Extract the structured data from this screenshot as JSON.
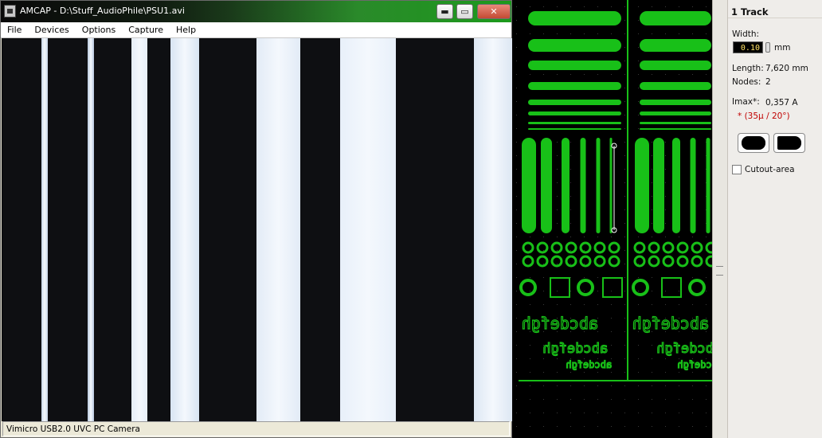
{
  "amcap": {
    "title": "AMCAP - D:\\Stuff_AudioPhile\\PSU1.avi",
    "menu": [
      "File",
      "Devices",
      "Options",
      "Capture",
      "Help"
    ],
    "status_text": "Vimicro USB2.0 UVC PC Camera",
    "window_buttons": {
      "minimize": "▬",
      "maximize": "▭",
      "close": "✕"
    }
  },
  "pcb_editor": {
    "silkscreen_text": [
      "abcdefgh",
      "abcdefgh",
      "abcdefgh"
    ],
    "colors": {
      "background": "#000000",
      "copper": "#18c018",
      "selected_track": "#ffffff"
    }
  },
  "properties_panel": {
    "header": "1 Track",
    "width_label": "Width:",
    "width_value": "0.10",
    "width_unit": "mm",
    "length_label": "Length:",
    "length_value": "7,620 mm",
    "nodes_label": "Nodes:",
    "nodes_value": "2",
    "imax_label": "Imax*:",
    "imax_value": "0,357 A",
    "imax_note": "* (35µ / 20°)",
    "cutout_label": "Cutout-area",
    "cutout_checked": false
  }
}
